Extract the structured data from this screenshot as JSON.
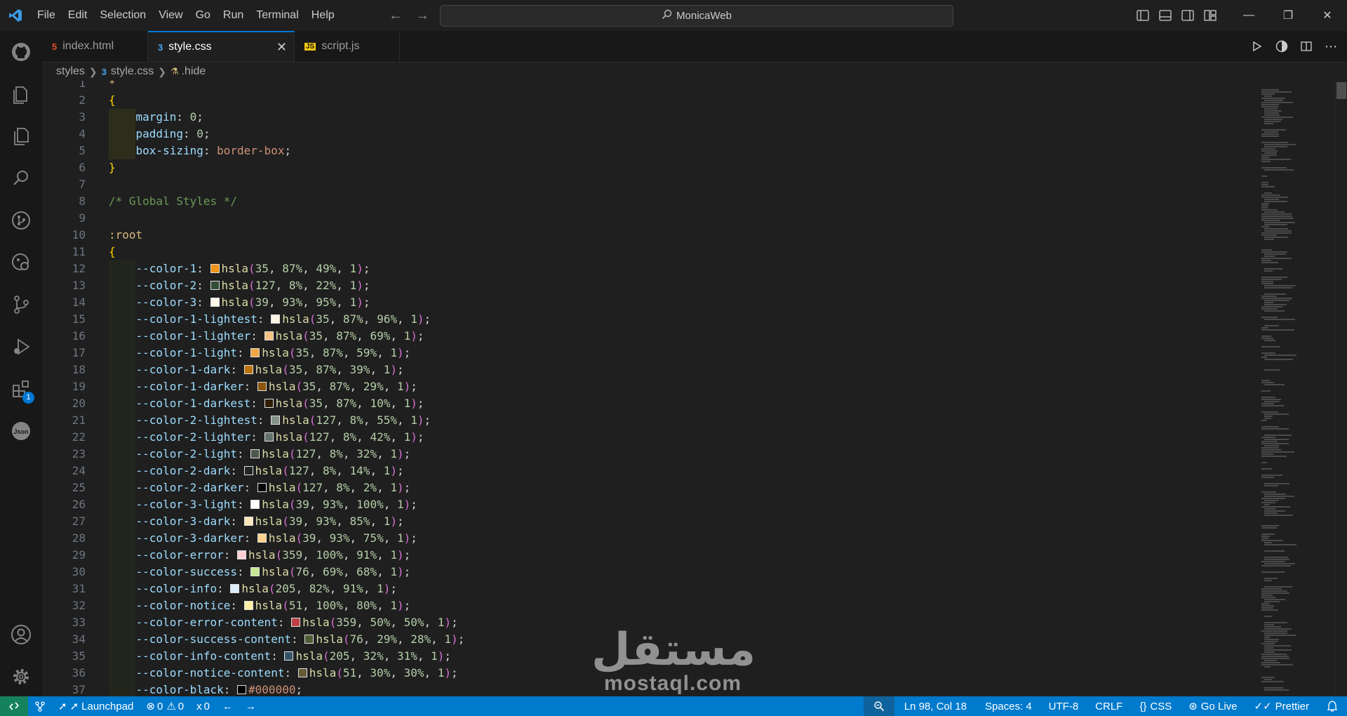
{
  "titlebar": {
    "menu": [
      "File",
      "Edit",
      "Selection",
      "View",
      "Go",
      "Run",
      "Terminal",
      "Help"
    ],
    "search_text": "MonicaWeb"
  },
  "activitybar": {
    "icons": [
      "github-icon",
      "explorer-icon",
      "copy-files-icon",
      "search-icon",
      "git-graph-icon",
      "remote-explorer-icon",
      "source-control-icon",
      "run-debug-icon",
      "extensions-icon",
      "json-icon"
    ],
    "extensions_badge": "1",
    "bottom_icons": [
      "account-icon",
      "settings-gear-icon"
    ]
  },
  "tabs": [
    {
      "label": "index.html",
      "type": "html",
      "active": false
    },
    {
      "label": "style.css",
      "type": "css",
      "active": true
    },
    {
      "label": "script.js",
      "type": "js",
      "active": false
    }
  ],
  "breadcrumb": {
    "folder": "styles",
    "file": "style.css",
    "symbol": ".hide"
  },
  "code_lines": [
    {
      "n": "1",
      "parts": [
        [
          "c-sel",
          "*"
        ]
      ]
    },
    {
      "n": "2",
      "parts": [
        [
          "c-brace",
          "{"
        ]
      ]
    },
    {
      "n": "3",
      "guide": true,
      "parts": [
        [
          "c-prop",
          "    margin"
        ],
        [
          "c-punc",
          ": "
        ],
        [
          "c-num",
          "0"
        ],
        [
          "c-punc",
          ";"
        ]
      ]
    },
    {
      "n": "4",
      "guide": true,
      "parts": [
        [
          "c-prop",
          "    padding"
        ],
        [
          "c-punc",
          ": "
        ],
        [
          "c-num",
          "0"
        ],
        [
          "c-punc",
          ";"
        ]
      ]
    },
    {
      "n": "5",
      "guide": true,
      "parts": [
        [
          "c-prop",
          "    box-sizing"
        ],
        [
          "c-punc",
          ": "
        ],
        [
          "c-val",
          "border-box"
        ],
        [
          "c-punc",
          ";"
        ]
      ]
    },
    {
      "n": "6",
      "parts": [
        [
          "c-brace",
          "}"
        ]
      ]
    },
    {
      "n": "7",
      "parts": []
    },
    {
      "n": "8",
      "parts": [
        [
          "c-com",
          "/* Global Styles */"
        ]
      ]
    },
    {
      "n": "9",
      "parts": []
    },
    {
      "n": "10",
      "parts": [
        [
          "c-sel",
          ":root"
        ]
      ]
    },
    {
      "n": "11",
      "parts": [
        [
          "c-brace",
          "{"
        ]
      ]
    },
    {
      "n": "12",
      "guide": true,
      "prop": "--color-1",
      "swatch": "#ee9418",
      "fn": "hsla",
      "args": "35, 87%, 49%, 1"
    },
    {
      "n": "13",
      "guide": true,
      "prop": "--color-2",
      "swatch": "#334d36",
      "fn": "hsla",
      "args": "127, 8%, 22%, 1"
    },
    {
      "n": "14",
      "guide": true,
      "prop": "--color-3",
      "swatch": "#fdf5e6",
      "fn": "hsla",
      "args": "39, 93%, 95%, 1"
    },
    {
      "n": "15",
      "guide": true,
      "prop": "--color-1-lightest",
      "swatch": "#fdf3e6",
      "fn": "hsla",
      "args": "35, 87%, 96%, 1"
    },
    {
      "n": "16",
      "guide": true,
      "prop": "--color-1-lighter",
      "swatch": "#f3c081",
      "fn": "hsla",
      "args": "35, 87%, 69%, 1"
    },
    {
      "n": "17",
      "guide": true,
      "prop": "--color-1-light",
      "swatch": "#efa743",
      "fn": "hsla",
      "args": "35, 87%, 59%, 1"
    },
    {
      "n": "18",
      "guide": true,
      "prop": "--color-1-dark",
      "swatch": "#bd730d",
      "fn": "hsla",
      "args": "35, 87%, 39%, 1"
    },
    {
      "n": "19",
      "guide": true,
      "prop": "--color-1-darker",
      "swatch": "#8b550a",
      "fn": "hsla",
      "args": "35, 87%, 29%, 1"
    },
    {
      "n": "20",
      "guide": true,
      "prop": "--color-1-darkest",
      "swatch": "#301d03",
      "fn": "hsla",
      "args": "35, 87%, 10%, 1"
    },
    {
      "n": "21",
      "guide": true,
      "prop": "--color-2-lightest",
      "swatch": "#84938a",
      "fn": "hsla",
      "args": "127, 8%, 55%, 1"
    },
    {
      "n": "22",
      "guide": true,
      "prop": "--color-2-lighter",
      "swatch": "#63726a",
      "fn": "hsla",
      "args": "127, 8%, 42%, 1"
    },
    {
      "n": "23",
      "guide": true,
      "prop": "--color-2-light",
      "swatch": "#4b564d",
      "fn": "hsla",
      "args": "127, 8%, 32%, 1"
    },
    {
      "n": "24",
      "guide": true,
      "prop": "--color-2-dark",
      "swatch": "#202722",
      "fn": "hsla",
      "args": "127, 8%, 14%, 1"
    },
    {
      "n": "25",
      "guide": true,
      "prop": "--color-2-darker",
      "swatch": "#050505",
      "fn": "hsla",
      "args": "127, 8%, 2%, 1"
    },
    {
      "n": "26",
      "guide": true,
      "prop": "--color-3-light",
      "swatch": "#ffffff",
      "fn": "hsla",
      "args": "39, 93%, 100%, 1"
    },
    {
      "n": "27",
      "guide": true,
      "prop": "--color-3-dark",
      "swatch": "#fde4bb",
      "fn": "hsla",
      "args": "39, 93%, 85%, 1"
    },
    {
      "n": "28",
      "guide": true,
      "prop": "--color-3-darker",
      "swatch": "#fbd38e",
      "fn": "hsla",
      "args": "39, 93%, 75%, 1"
    },
    {
      "n": "29",
      "guide": true,
      "prop": "--color-error",
      "swatch": "#ffd1d3",
      "fn": "hsla",
      "args": "359, 100%, 91%, 1"
    },
    {
      "n": "30",
      "guide": true,
      "prop": "--color-success",
      "swatch": "#c5e694",
      "fn": "hsla",
      "args": "76, 69%, 68%, 1"
    },
    {
      "n": "31",
      "guide": true,
      "prop": "--color-info",
      "swatch": "#dcedfa",
      "fn": "hsla",
      "args": "205, 82%, 91%, 1"
    },
    {
      "n": "32",
      "guide": true,
      "prop": "--color-notice",
      "swatch": "#fff0a3",
      "fn": "hsla",
      "args": "51, 100%, 80%, 1"
    },
    {
      "n": "33",
      "guide": true,
      "prop": "--color-error-content",
      "swatch": "#bf4044",
      "fn": "hsla",
      "args": "359, 50%, 50%, 1"
    },
    {
      "n": "34",
      "guide": true,
      "prop": "--color-success-content",
      "swatch": "#505c33",
      "fn": "hsla",
      "args": "76, 29%, 28%, 1"
    },
    {
      "n": "35",
      "guide": true,
      "prop": "--color-info-content",
      "swatch": "#365469",
      "fn": "hsla",
      "args": "205, 32%, 31%, 1"
    },
    {
      "n": "36",
      "guide": true,
      "prop": "--color-notice-content",
      "swatch": "#645b36",
      "fn": "hsla",
      "args": "51, 30%, 30%, 1"
    },
    {
      "n": "37",
      "guide": true,
      "prop": "--color-black",
      "swatch": "#000000",
      "hex": "#000000"
    }
  ],
  "watermark": {
    "arabic": "مستقل",
    "latin": "mostaql.com"
  },
  "statusbar": {
    "launchpad": "Launchpad",
    "errors": "0",
    "warnings": "0",
    "ports": "0",
    "position": "Ln 98, Col 18",
    "spaces": "Spaces: 4",
    "encoding": "UTF-8",
    "eol": "CRLF",
    "language": "CSS",
    "golive": "Go Live",
    "prettier": "Prettier"
  },
  "colors": {
    "accent": "#007acc",
    "remote": "#16825d",
    "active_tab_border": "#0078d4"
  }
}
